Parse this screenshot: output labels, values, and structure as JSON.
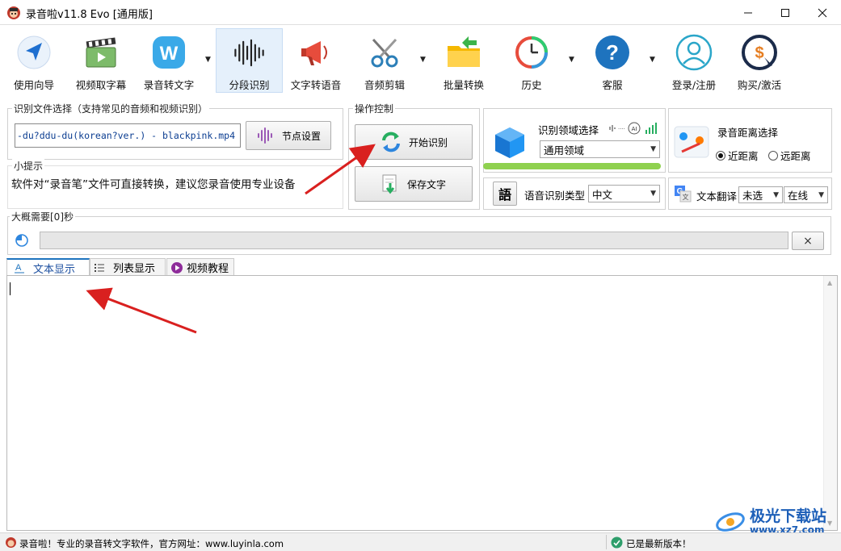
{
  "window": {
    "title": "录音啦v11.8 Evo [通用版]",
    "minimize_icon": "minimize-icon",
    "maximize_icon": "maximize-icon",
    "close_icon": "close-icon"
  },
  "toolbar": {
    "items": [
      {
        "label": "使用向导",
        "icon": "navigation-arrow-icon"
      },
      {
        "label": "视频取字幕",
        "icon": "film-clapper-icon"
      },
      {
        "label": "录音转文字",
        "icon": "w-logo-icon"
      },
      {
        "label": "分段识别",
        "icon": "waveform-icon"
      },
      {
        "label": "文字转语音",
        "icon": "megaphone-icon"
      },
      {
        "label": "音频剪辑",
        "icon": "scissors-icon"
      },
      {
        "label": "批量转换",
        "icon": "folder-icon"
      },
      {
        "label": "历史",
        "icon": "history-clock-icon"
      },
      {
        "label": "客服",
        "icon": "help-icon"
      },
      {
        "label": "登录/注册",
        "icon": "user-icon"
      },
      {
        "label": "购买/激活",
        "icon": "purchase-icon"
      }
    ]
  },
  "file_select": {
    "title": "识别文件选择（支持常见的音频和视频识别）",
    "filename": "-du?ddu-du(korean?ver.) - blackpink.mp4",
    "node_button": "节点设置"
  },
  "hint": {
    "title": "小提示",
    "text": "软件对“录音笔”文件可直接转换，建议您录音使用专业设备"
  },
  "operation": {
    "title": "操作控制",
    "start_button": "开始识别",
    "save_button": "保存文字"
  },
  "domain": {
    "title": "识别领域选择",
    "value": "通用领域"
  },
  "distance": {
    "title": "录音距离选择",
    "options": [
      "近距离",
      "远距离"
    ],
    "selected": "近距离"
  },
  "language": {
    "icon_text": "語",
    "label": "语音识别类型",
    "value": "中文"
  },
  "translate": {
    "label": "文本翻译",
    "value1": "未选",
    "value2": "在线"
  },
  "progress": {
    "title": "大概需要[0]秒",
    "value": 0,
    "cancel": "×"
  },
  "tabs": [
    {
      "label": "文本显示",
      "icon": "text-icon",
      "active": true
    },
    {
      "label": "列表显示",
      "icon": "list-icon",
      "active": false
    },
    {
      "label": "视频教程",
      "icon": "play-icon",
      "active": false
    }
  ],
  "status": {
    "left": "录音啦！专业的录音转文字软件，官方网址：www.luyinla.com",
    "right": "已是最新版本！"
  },
  "watermark": {
    "text": "极光下载站",
    "url": "www.xz7.com"
  },
  "colors": {
    "accent": "#1e73be",
    "green_bar": "#8fd14f",
    "arrow": "#d9201f"
  }
}
